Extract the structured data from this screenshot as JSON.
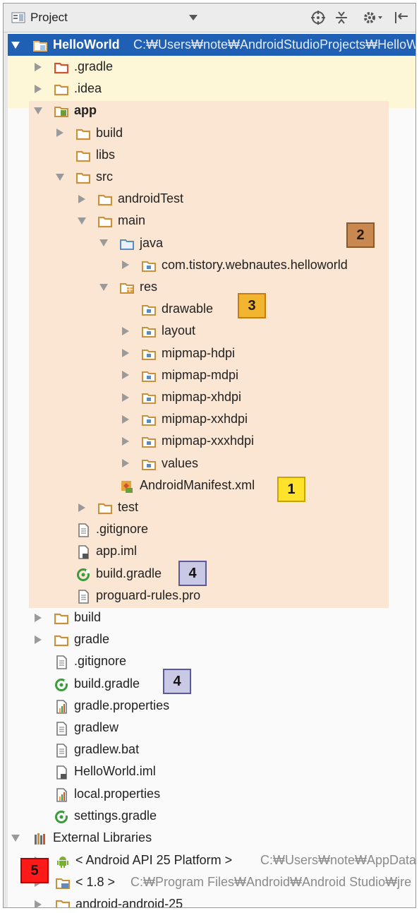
{
  "header": {
    "view_selector": "Project",
    "locate_icon": "crosshair-icon",
    "collapse_icon": "collapse-all-icon",
    "settings_icon": "gear-icon",
    "hide_icon": "hide-panel-icon"
  },
  "tree": {
    "root": {
      "label": "HelloWorld",
      "path": "C:₩Users₩note₩AndroidStudioProjects₩HelloW"
    },
    "rows": [
      ".gradle",
      ".idea",
      "app",
      "build",
      "libs",
      "src",
      "androidTest",
      "main",
      "java",
      "com.tistory.webnautes.helloworld",
      "res",
      "drawable",
      "layout",
      "mipmap-hdpi",
      "mipmap-mdpi",
      "mipmap-xhdpi",
      "mipmap-xxhdpi",
      "mipmap-xxxhdpi",
      "values",
      "AndroidManifest.xml",
      "test",
      ".gitignore",
      "app.iml",
      "build.gradle",
      "proguard-rules.pro",
      "build",
      "gradle",
      ".gitignore",
      "build.gradle",
      "gradle.properties",
      "gradlew",
      "gradlew.bat",
      "HelloWorld.iml",
      "local.properties",
      "settings.gradle",
      "External Libraries"
    ],
    "android_api": {
      "label": "< Android API 25 Platform >",
      "path": "C:₩Users₩note₩AppData"
    },
    "jdk": {
      "label": "< 1.8 >",
      "path": "C:₩Program Files₩Android₩Android Studio₩jre"
    },
    "partial": "android-android-25"
  },
  "badges": {
    "b1": "1",
    "b2": "2",
    "b3": "3",
    "b4a": "4",
    "b4b": "4",
    "b5": "5"
  },
  "colors": {
    "selection": "#1f5fb4",
    "module_highlight": "#fbe6d4",
    "root_row_highlight": "#fdf7d8",
    "path_gray": "#8a8a8a",
    "folder_orange": "#c9913a",
    "gradle_green": "#3b9c3b",
    "android_green": "#78b12f"
  }
}
